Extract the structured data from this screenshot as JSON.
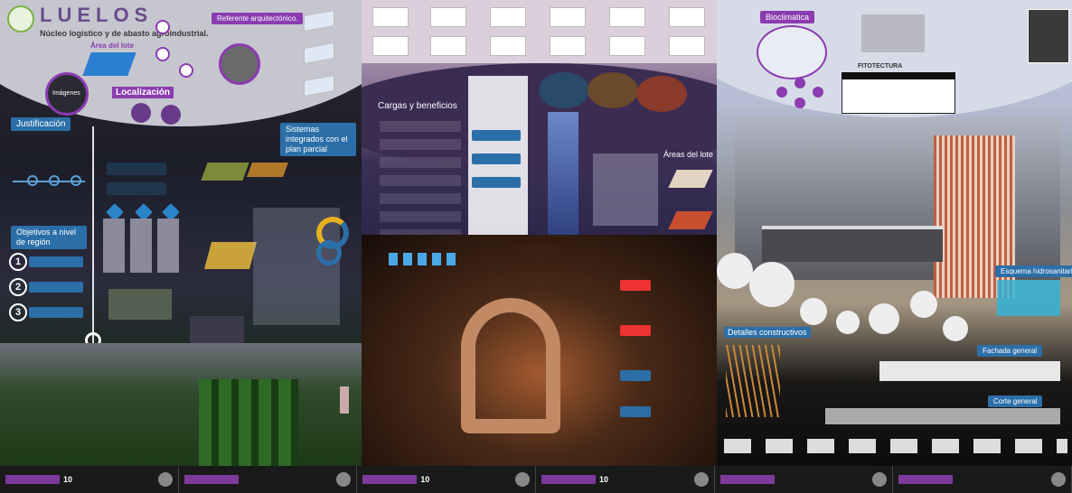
{
  "poster": {
    "brand": "LUELOS",
    "subtitle": "Núcleo logístico y de abasto agroindustrial.",
    "section_area_lote": "Área del lote",
    "section_localizacion": "Localización",
    "section_referente": "Referente arquitectónico.",
    "section_imagenes": "Imágenes",
    "section_justificacion": "Justificación",
    "section_sistemas": "Sistemas integrados con el plan parcial",
    "section_objetivos": "Objetivos a nivel de región",
    "section_cargas": "Cargas y beneficios",
    "section_areas_lote": "Áreas del lote",
    "section_biociclimatica": "Bioclimatica",
    "section_fitotectura": "FITOTECTURA",
    "section_esquema": "Esquema hidrosanitario",
    "section_detalles": "Detalles constructivos",
    "section_fachada": "Fachada general",
    "section_corte": "Corte general",
    "objective_numbers": [
      "1",
      "2",
      "3"
    ],
    "footer_sheets": [
      "10",
      "10",
      "10"
    ]
  },
  "colors": {
    "accent_purple": "#8a3cb0",
    "accent_blue": "#2c6fa8",
    "footer_bar": "#7c3a9a"
  }
}
